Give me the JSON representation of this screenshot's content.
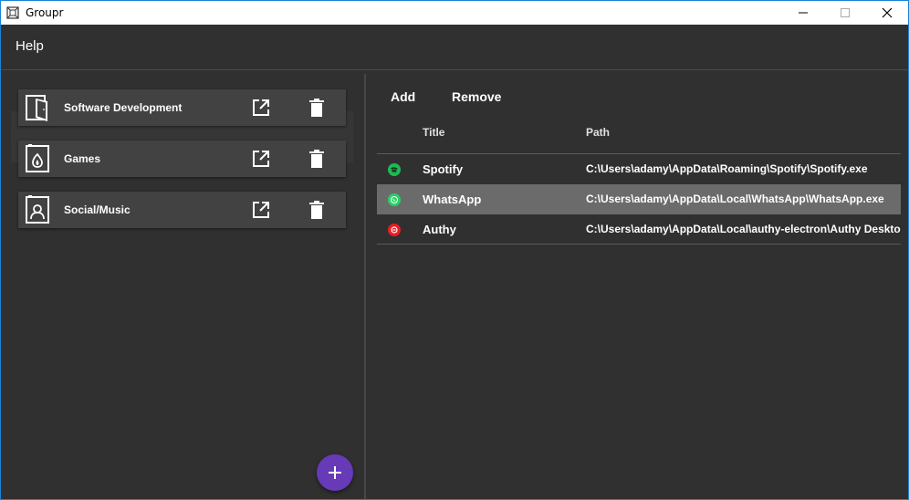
{
  "window": {
    "title": "Groupr"
  },
  "menu": {
    "help_label": "Help"
  },
  "groups": [
    {
      "label": "Software Development",
      "icon": "open-door-icon"
    },
    {
      "label": "Games",
      "icon": "flame-card-icon"
    },
    {
      "label": "Social/Music",
      "icon": "person-card-icon"
    }
  ],
  "toolbar": {
    "add_label": "Add",
    "remove_label": "Remove"
  },
  "table": {
    "headers": {
      "title": "Title",
      "path": "Path"
    },
    "rows": [
      {
        "title": "Spotify",
        "path": "C:\\Users\\adamy\\AppData\\Roaming\\Spotify\\Spotify.exe",
        "icon": "spotify-icon",
        "color": "#1db954"
      },
      {
        "title": "WhatsApp",
        "path": "C:\\Users\\adamy\\AppData\\Local\\WhatsApp\\WhatsApp.exe",
        "icon": "whatsapp-icon",
        "color": "#25d366"
      },
      {
        "title": "Authy",
        "path": "C:\\Users\\adamy\\AppData\\Local\\authy-electron\\Authy Desktop.exe",
        "icon": "authy-icon",
        "color": "#ec1c24"
      }
    ]
  },
  "colors": {
    "accent": "#673ab7",
    "background": "#303030",
    "card": "#424242",
    "selected_row": "#6b6b6b"
  }
}
